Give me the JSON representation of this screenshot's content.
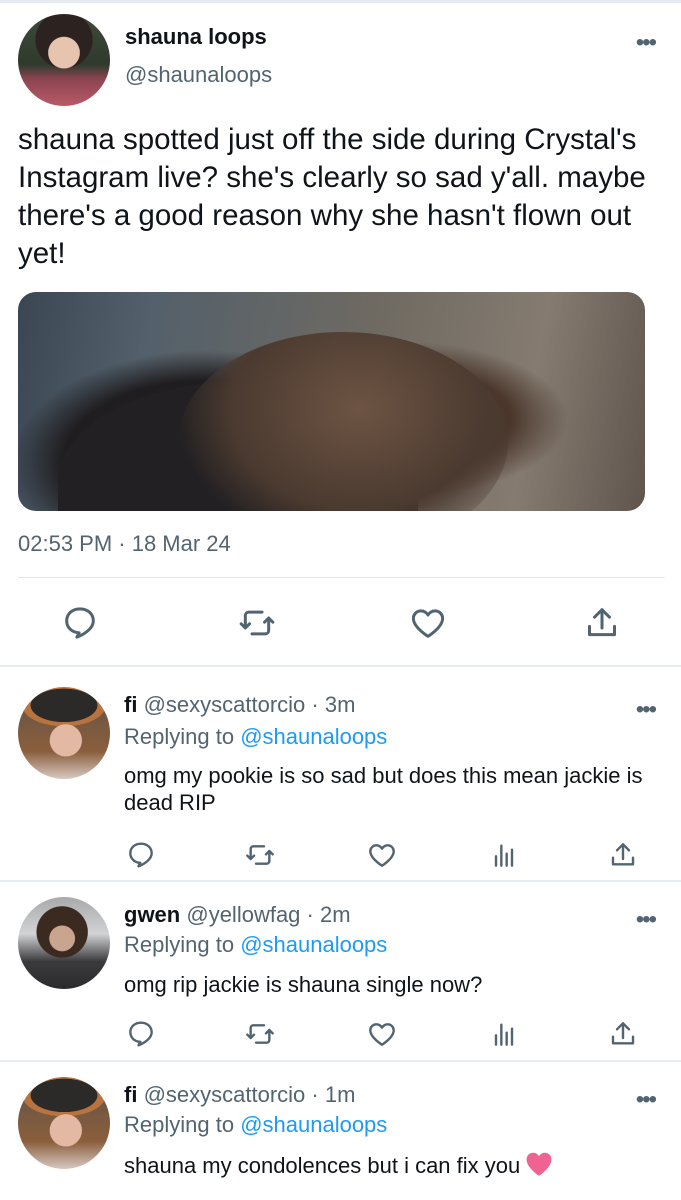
{
  "main_tweet": {
    "display_name": "shauna loops",
    "handle": "@shaunaloops",
    "more_icon": "•••",
    "text": "shauna spotted just off the side during Crystal's Instagram live? she's clearly so sad y'all. maybe there's a good reason why she hasn't flown out yet!",
    "timestamp": "02:53 PM · 18 Mar 24",
    "actions": [
      "reply-icon",
      "retweet-icon",
      "like-icon",
      "share-icon"
    ]
  },
  "replies": [
    {
      "display_name": "fi",
      "handle": "@sexyscattorcio",
      "age": "3m",
      "replying_prefix": "Replying to ",
      "replying_to": "@shaunaloops",
      "text": "omg my pookie is so sad but does this mean jackie is dead RIP",
      "more_icon": "•••"
    },
    {
      "display_name": "gwen",
      "handle": "@yellowfag",
      "age": "2m",
      "replying_prefix": "Replying to ",
      "replying_to": "@shaunaloops",
      "text": "omg rip jackie is shauna single now?",
      "more_icon": "•••"
    },
    {
      "display_name": "fi",
      "handle": "@sexyscattorcio",
      "age": "1m",
      "replying_prefix": "Replying to ",
      "replying_to": "@shaunaloops",
      "text": "shauna my condolences but i can fix you",
      "more_icon": "•••",
      "emoji": "pink-heart-icon"
    }
  ],
  "colors": {
    "text_primary": "#0f1419",
    "text_secondary": "#536471",
    "link": "#1d9bf0",
    "divider": "#e6ecf0",
    "heart_emoji": "#f06292"
  }
}
